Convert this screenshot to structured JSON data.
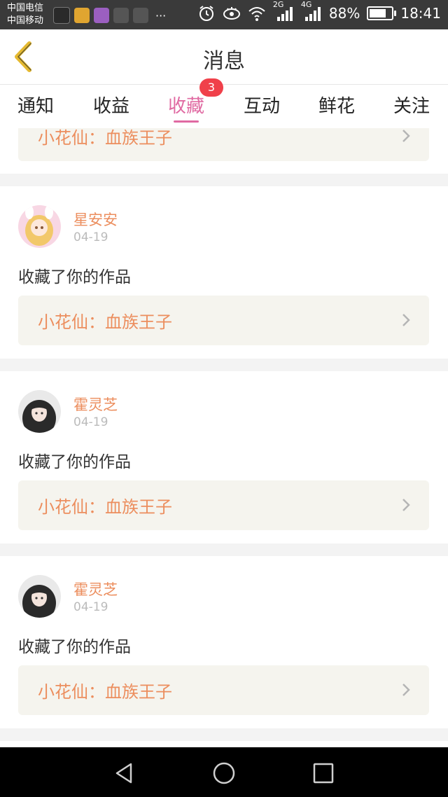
{
  "status_bar": {
    "carrier_1": "中国电信",
    "carrier_2": "中国移动",
    "more": "···",
    "net_2g": "2G",
    "net_4g": "4G",
    "battery": "88%",
    "battery_level": 0.88,
    "time": "18:41",
    "icons": [
      "app-icon-1",
      "app-icon-2",
      "app-icon-3",
      "app-icon-4",
      "app-icon-5",
      "alarm-icon",
      "eye-icon",
      "wifi-icon",
      "signal-icon",
      "signal-icon",
      "battery-icon"
    ]
  },
  "header": {
    "title": "消息",
    "back_icon": "back-chevron-icon"
  },
  "tabs": [
    {
      "label": "通知"
    },
    {
      "label": "收益"
    },
    {
      "label": "收藏",
      "active": true,
      "badge": "3"
    },
    {
      "label": "互动"
    },
    {
      "label": "鲜花"
    },
    {
      "label": "关注"
    }
  ],
  "messages": [
    {
      "work": "小花仙：血族王子"
    },
    {
      "user": "星安安",
      "date": "04-19",
      "action": "收藏了你的作品",
      "work": "小花仙：血族王子"
    },
    {
      "user": "霍灵芝",
      "date": "04-19",
      "action": "收藏了你的作品",
      "work": "小花仙：血族王子"
    },
    {
      "user": "霍灵芝",
      "date": "04-19",
      "action": "收藏了你的作品",
      "work": "小花仙：血族王子"
    }
  ],
  "colors": {
    "accent_pink": "#e06aa2",
    "name_orange": "#ec8e5e",
    "badge_red": "#f0404a",
    "work_bg": "#f5f4ee",
    "back_yellow": "#e5b930"
  },
  "navbar": {
    "icons": [
      "nav-back-icon",
      "nav-home-icon",
      "nav-recents-icon"
    ]
  }
}
